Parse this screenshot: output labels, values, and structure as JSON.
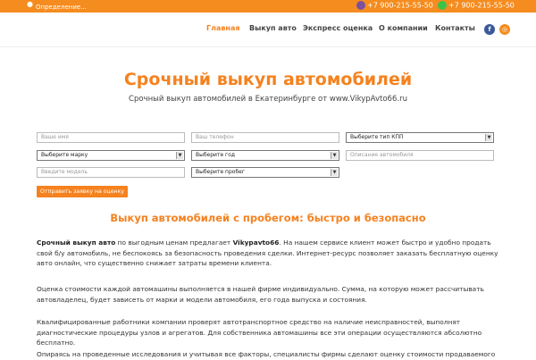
{
  "topbar": {
    "location_label": "Определение...",
    "phone1": "+7 900-215-55-50",
    "phone2": "+7 900-215-55-50",
    "phone1_icon": "viber-icon",
    "phone2_icon": "whatsapp-icon",
    "color": "#f58c1f"
  },
  "nav": {
    "items": [
      {
        "label": "Главная",
        "active": true
      },
      {
        "label": "Выкуп авто",
        "active": false
      },
      {
        "label": "Экспресс оценка",
        "active": false
      },
      {
        "label": "О компании",
        "active": false
      },
      {
        "label": "Контакты",
        "active": false
      }
    ],
    "social": [
      {
        "name": "facebook-icon",
        "glyph": "f",
        "color": "#3b5998"
      },
      {
        "name": "instagram-icon",
        "glyph": "◎",
        "color": "#f58c1f"
      }
    ]
  },
  "hero": {
    "title": "Срочный выкуп автомобилей",
    "subtitle": "Срочный выкуп  автомобилей в Екатеринбурге от www.VikypAvto66.ru"
  },
  "form": {
    "name_placeholder": "Ваше имя",
    "phone_placeholder": "Ваш телефон",
    "kpp_select": "Выберите тип КПП",
    "brand_select": "Выберите марку",
    "year_select": "Выберите год",
    "description_placeholder": "Описание автомобиля",
    "model_placeholder": "Введите модель",
    "mileage_select": "Выберите пробег",
    "submit_label": "Отправить заявку на оценку"
  },
  "article": {
    "title": "Выкуп автомобилей с пробегом: быстро и безопасно",
    "p1_bold1": "Срочный выкуп авто",
    "p1_text1": " по выгодным ценам предлагает ",
    "p1_bold2": "Vikypavto66",
    "p1_text2": ". На нашем сервисе клиент может быстро и удобно продать свой б/у автомобиль, не беспокоясь за безопасность проведения сделки. Интернет-ресурс позволяет заказать бесплатную оценку авто онлайн, что существенно снижает затраты времени клиента.",
    "p2": "   Оценка стоимости каждой автомашины выполняется в нашей фирме индивидуально. Сумма, на которую может рассчитывать автовладелец, будет зависеть от марки и модели автомобиля, его года выпуска и состояния.",
    "p3": "Квалифицированные работники компании проверят автотранспортное средство на наличие неисправностей, выполнят диагностические процедуры узлов и агрегатов. Для собственника автомашины все эти операции осуществляются абсолютно бесплатно.",
    "p4": "Опираясь на проведенные исследования и учитывая все факторы, специалисты фирмы сделают оценку стоимости продаваемого"
  }
}
